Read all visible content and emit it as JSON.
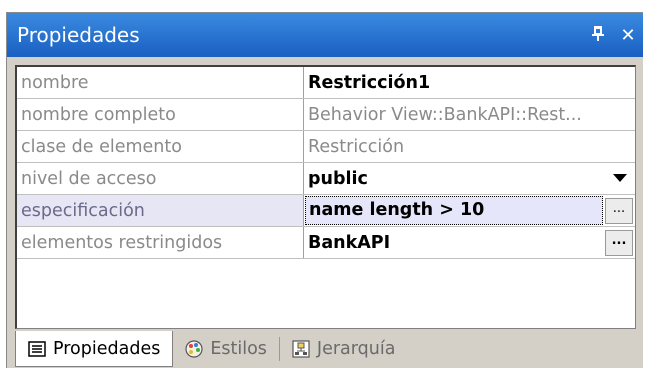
{
  "window": {
    "title": "Propiedades",
    "pin_icon": "pin-icon",
    "close_icon": "close-icon",
    "pin_glyph": "ᵖ",
    "close_glyph": "✕"
  },
  "properties": [
    {
      "name": "nombre",
      "value": "Restricción1",
      "style": "bold"
    },
    {
      "name": "nombre completo",
      "value": "Behavior View::BankAPI::Rest...",
      "style": "readonly"
    },
    {
      "name": "clase de elemento",
      "value": "Restricción",
      "style": "readonly"
    },
    {
      "name": "nivel de acceso",
      "value": "public",
      "style": "bold",
      "control": "dropdown"
    },
    {
      "name": "especificación",
      "value": "name length > 10",
      "style": "editing",
      "control": "ellipsis"
    },
    {
      "name": "elementos restringidos",
      "value": "BankAPI",
      "style": "bold",
      "control": "ellipsis"
    }
  ],
  "ellipsis_label": "...",
  "tabs": [
    {
      "label": "Propiedades",
      "icon": "properties-icon",
      "active": true
    },
    {
      "label": "Estilos",
      "icon": "palette-icon",
      "active": false
    },
    {
      "label": "Jerarquía",
      "icon": "hierarchy-icon",
      "active": false
    }
  ]
}
